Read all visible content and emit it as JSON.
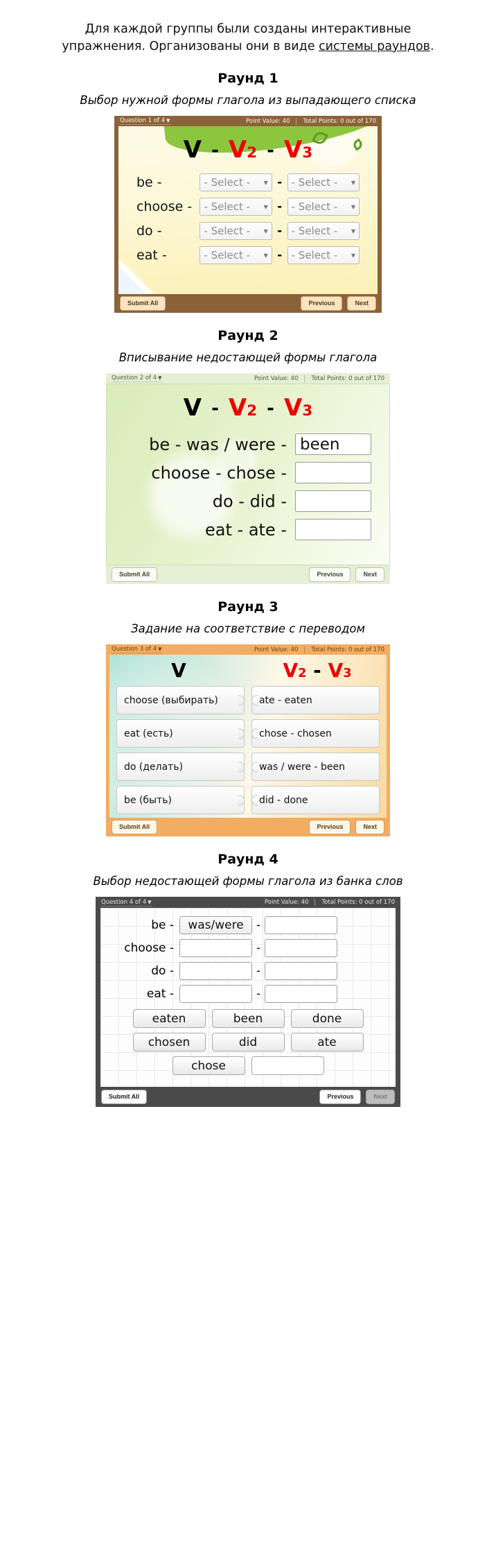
{
  "intro": {
    "line1": "Для каждой группы были созданы интерактивные",
    "line2_before": "упражнения. Организованы они в виде ",
    "line2_link": "системы раундов",
    "line2_after": "."
  },
  "common": {
    "point_value": "Point Value: 40",
    "total_points": "Total Points: 0 out of 170",
    "caret": "▼",
    "submit": "Submit All",
    "previous": "Previous",
    "next": "Next",
    "dash": "-",
    "header_v": "V",
    "header_v2_main": "V",
    "header_v2_sub": "2",
    "header_v3_main": "V",
    "header_v3_sub": "3",
    "select_placeholder": "- Select -",
    "select_caret": "▼"
  },
  "colors": {
    "round1_bar": "#8b6239",
    "round2_bar": "#e5efd4",
    "round3_bar": "#f2ad62",
    "round4_bar": "#4a4a4a",
    "accent_red": "#ee0000",
    "green_swoosh": "#8cc63e",
    "blue_corner": "#4da0ec"
  },
  "rounds": [
    {
      "title": "Раунд 1",
      "subtitle": "Выбор нужной формы глагола из выпадающего списка",
      "question_label": "Question 1 of 4",
      "rows": [
        {
          "verb": "be -",
          "v2": "- Select -",
          "v3": "- Select -"
        },
        {
          "verb": "choose -",
          "v2": "- Select -",
          "v3": "- Select -"
        },
        {
          "verb": "do -",
          "v2": "- Select -",
          "v3": "- Select -"
        },
        {
          "verb": "eat -",
          "v2": "- Select -",
          "v3": "- Select -"
        }
      ]
    },
    {
      "title": "Раунд 2",
      "subtitle": "Вписывание недостающей формы глагола",
      "question_label": "Question 2 of 4",
      "rows": [
        {
          "prompt": "be -   was / were -",
          "answer": "been"
        },
        {
          "prompt": "choose - chose -",
          "answer": ""
        },
        {
          "prompt": "do -      did -",
          "answer": ""
        },
        {
          "prompt": "eat -     ate -",
          "answer": ""
        }
      ]
    },
    {
      "title": "Раунд 3",
      "subtitle": "Задание на соответствие с переводом",
      "question_label": "Question 3 of 4",
      "col_left_header": "V",
      "col_right_header_v2": "V",
      "col_right_header_v2_sub": "2",
      "col_right_header_dash": " - ",
      "col_right_header_v3": "V",
      "col_right_header_v3_sub": "3",
      "pairs": [
        {
          "left": "choose (выбирать)",
          "right": "ate - eaten"
        },
        {
          "left": "eat (есть)",
          "right": "chose - chosen"
        },
        {
          "left": "do (делать)",
          "right": "was / were - been"
        },
        {
          "left": "be (быть)",
          "right": "did - done"
        }
      ]
    },
    {
      "title": "Раунд 4",
      "subtitle": "Выбор недостающей формы глагола из банка слов",
      "question_label": "Question 4 of 4",
      "rows": [
        {
          "verb": "be -",
          "v2": "was/were",
          "v3": ""
        },
        {
          "verb": "choose -",
          "v2": "",
          "v3": ""
        },
        {
          "verb": "do -",
          "v2": "",
          "v3": ""
        },
        {
          "verb": "eat -",
          "v2": "",
          "v3": ""
        }
      ],
      "word_bank": [
        [
          "eaten",
          "been",
          "done"
        ],
        [
          "chosen",
          "did",
          "ate"
        ],
        [
          "chose",
          ""
        ]
      ],
      "next_disabled": true
    }
  ]
}
